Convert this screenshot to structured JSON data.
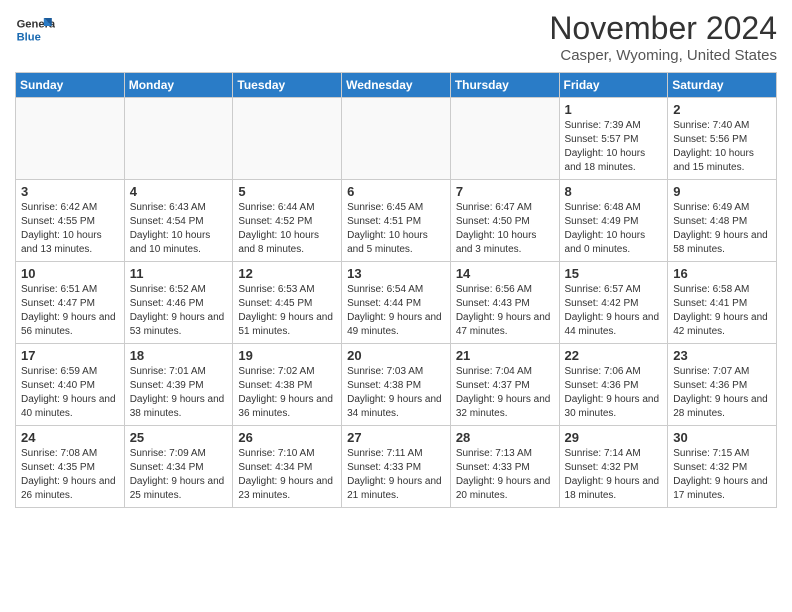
{
  "header": {
    "logo_general": "General",
    "logo_blue": "Blue",
    "month_year": "November 2024",
    "location": "Casper, Wyoming, United States"
  },
  "days_of_week": [
    "Sunday",
    "Monday",
    "Tuesday",
    "Wednesday",
    "Thursday",
    "Friday",
    "Saturday"
  ],
  "weeks": [
    [
      {
        "day": "",
        "info": ""
      },
      {
        "day": "",
        "info": ""
      },
      {
        "day": "",
        "info": ""
      },
      {
        "day": "",
        "info": ""
      },
      {
        "day": "",
        "info": ""
      },
      {
        "day": "1",
        "info": "Sunrise: 7:39 AM\nSunset: 5:57 PM\nDaylight: 10 hours and 18 minutes."
      },
      {
        "day": "2",
        "info": "Sunrise: 7:40 AM\nSunset: 5:56 PM\nDaylight: 10 hours and 15 minutes."
      }
    ],
    [
      {
        "day": "3",
        "info": "Sunrise: 6:42 AM\nSunset: 4:55 PM\nDaylight: 10 hours and 13 minutes."
      },
      {
        "day": "4",
        "info": "Sunrise: 6:43 AM\nSunset: 4:54 PM\nDaylight: 10 hours and 10 minutes."
      },
      {
        "day": "5",
        "info": "Sunrise: 6:44 AM\nSunset: 4:52 PM\nDaylight: 10 hours and 8 minutes."
      },
      {
        "day": "6",
        "info": "Sunrise: 6:45 AM\nSunset: 4:51 PM\nDaylight: 10 hours and 5 minutes."
      },
      {
        "day": "7",
        "info": "Sunrise: 6:47 AM\nSunset: 4:50 PM\nDaylight: 10 hours and 3 minutes."
      },
      {
        "day": "8",
        "info": "Sunrise: 6:48 AM\nSunset: 4:49 PM\nDaylight: 10 hours and 0 minutes."
      },
      {
        "day": "9",
        "info": "Sunrise: 6:49 AM\nSunset: 4:48 PM\nDaylight: 9 hours and 58 minutes."
      }
    ],
    [
      {
        "day": "10",
        "info": "Sunrise: 6:51 AM\nSunset: 4:47 PM\nDaylight: 9 hours and 56 minutes."
      },
      {
        "day": "11",
        "info": "Sunrise: 6:52 AM\nSunset: 4:46 PM\nDaylight: 9 hours and 53 minutes."
      },
      {
        "day": "12",
        "info": "Sunrise: 6:53 AM\nSunset: 4:45 PM\nDaylight: 9 hours and 51 minutes."
      },
      {
        "day": "13",
        "info": "Sunrise: 6:54 AM\nSunset: 4:44 PM\nDaylight: 9 hours and 49 minutes."
      },
      {
        "day": "14",
        "info": "Sunrise: 6:56 AM\nSunset: 4:43 PM\nDaylight: 9 hours and 47 minutes."
      },
      {
        "day": "15",
        "info": "Sunrise: 6:57 AM\nSunset: 4:42 PM\nDaylight: 9 hours and 44 minutes."
      },
      {
        "day": "16",
        "info": "Sunrise: 6:58 AM\nSunset: 4:41 PM\nDaylight: 9 hours and 42 minutes."
      }
    ],
    [
      {
        "day": "17",
        "info": "Sunrise: 6:59 AM\nSunset: 4:40 PM\nDaylight: 9 hours and 40 minutes."
      },
      {
        "day": "18",
        "info": "Sunrise: 7:01 AM\nSunset: 4:39 PM\nDaylight: 9 hours and 38 minutes."
      },
      {
        "day": "19",
        "info": "Sunrise: 7:02 AM\nSunset: 4:38 PM\nDaylight: 9 hours and 36 minutes."
      },
      {
        "day": "20",
        "info": "Sunrise: 7:03 AM\nSunset: 4:38 PM\nDaylight: 9 hours and 34 minutes."
      },
      {
        "day": "21",
        "info": "Sunrise: 7:04 AM\nSunset: 4:37 PM\nDaylight: 9 hours and 32 minutes."
      },
      {
        "day": "22",
        "info": "Sunrise: 7:06 AM\nSunset: 4:36 PM\nDaylight: 9 hours and 30 minutes."
      },
      {
        "day": "23",
        "info": "Sunrise: 7:07 AM\nSunset: 4:36 PM\nDaylight: 9 hours and 28 minutes."
      }
    ],
    [
      {
        "day": "24",
        "info": "Sunrise: 7:08 AM\nSunset: 4:35 PM\nDaylight: 9 hours and 26 minutes."
      },
      {
        "day": "25",
        "info": "Sunrise: 7:09 AM\nSunset: 4:34 PM\nDaylight: 9 hours and 25 minutes."
      },
      {
        "day": "26",
        "info": "Sunrise: 7:10 AM\nSunset: 4:34 PM\nDaylight: 9 hours and 23 minutes."
      },
      {
        "day": "27",
        "info": "Sunrise: 7:11 AM\nSunset: 4:33 PM\nDaylight: 9 hours and 21 minutes."
      },
      {
        "day": "28",
        "info": "Sunrise: 7:13 AM\nSunset: 4:33 PM\nDaylight: 9 hours and 20 minutes."
      },
      {
        "day": "29",
        "info": "Sunrise: 7:14 AM\nSunset: 4:32 PM\nDaylight: 9 hours and 18 minutes."
      },
      {
        "day": "30",
        "info": "Sunrise: 7:15 AM\nSunset: 4:32 PM\nDaylight: 9 hours and 17 minutes."
      }
    ]
  ]
}
